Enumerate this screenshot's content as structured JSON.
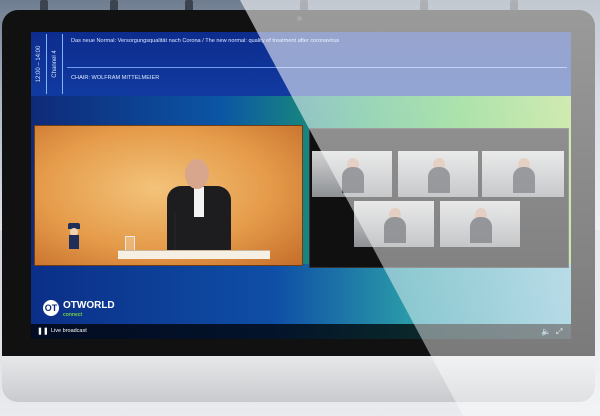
{
  "stream": {
    "time_range": "12:00 – 14:00",
    "channel": "Channel 4",
    "session_title": "Das neue Normal: Versorgungsqualität nach Corona / The new normal: quality of treatment after coronavirus",
    "chair": "CHAIR: WOLFRAM MITTELMEIER"
  },
  "branding": {
    "logo_mark": "OT",
    "logo_text": "OTWORLD",
    "logo_sub": "connect"
  },
  "player": {
    "live_label": "Live broadcast",
    "play_icon": "pause-icon",
    "volume_icon": "volume-icon",
    "fullscreen_icon": "fullscreen-icon"
  },
  "video_call": {
    "participants": [
      "participant-1",
      "participant-2",
      "participant-3",
      "participant-4",
      "participant-5",
      "participant-6"
    ]
  },
  "colors": {
    "accent_blue": "#0e2a78",
    "accent_green": "#74d23f"
  }
}
